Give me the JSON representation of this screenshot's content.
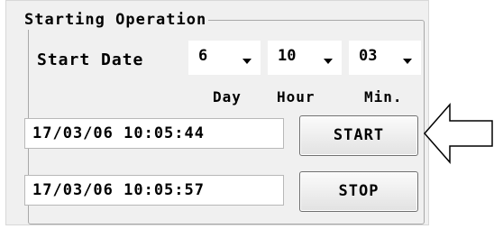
{
  "group": {
    "title": "Starting Operation"
  },
  "start_date": {
    "label": "Start Date",
    "day": "6",
    "hour": "10",
    "minute": "03",
    "units": {
      "day": "Day",
      "hour": "Hour",
      "minute": "Min."
    }
  },
  "start": {
    "timestamp": "17/03/06 10:05:44",
    "button_label": "START"
  },
  "stop": {
    "timestamp": "17/03/06 10:05:57",
    "button_label": "STOP"
  },
  "annotation": {
    "icon": "left-arrow-icon"
  }
}
